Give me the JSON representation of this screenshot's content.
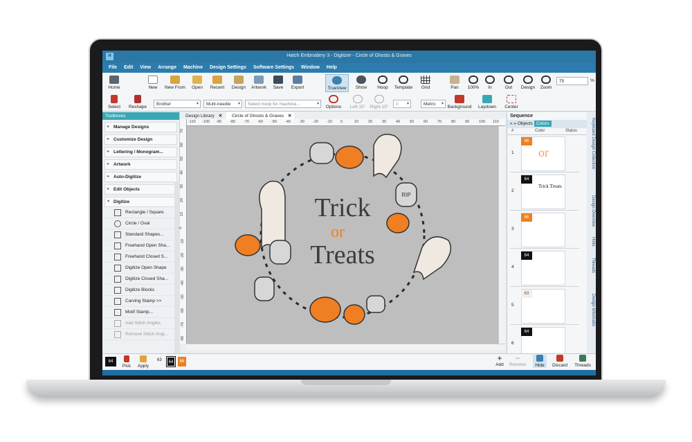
{
  "window": {
    "title": "Hatch Embroidery 3 - Digitizer - Circle of Ghosts & Graves",
    "app_icon": "H"
  },
  "menu": [
    "File",
    "Edit",
    "View",
    "Arrange",
    "Machine",
    "Design Settings",
    "Software Settings",
    "Window",
    "Help"
  ],
  "toolbar": {
    "row1": [
      "Home",
      "New",
      "New From",
      "Open",
      "Recent",
      "Design",
      "Artwork",
      "Save",
      "Export",
      "TrueView",
      "Show",
      "Hoop",
      "Template",
      "Grid",
      "Pan",
      "100%",
      "In",
      "Out",
      "Design",
      "Zoom"
    ],
    "row2": [
      "Select",
      "Reshape",
      "Options",
      "Left 15°",
      "Right 15°",
      "Background",
      "Laydown",
      "Center"
    ],
    "machine_brand": "Brother",
    "machine_type": "Multi-needle",
    "hoop_placeholder": "Select hoop for machine...",
    "angle_value": "0",
    "units": "Metric",
    "zoom_value": "75",
    "zoom_unit": "%"
  },
  "toolboxes": {
    "header": "Toolboxes",
    "sections": [
      "Manage Designs",
      "Customize Design",
      "Lettering / Monogram...",
      "Artwork",
      "Auto-Digitize",
      "Edit Objects",
      "Digitize"
    ],
    "tools": [
      "Rectangle / Square",
      "Circle / Oval",
      "Standard Shapes...",
      "Freehand Open Sha...",
      "Freehand Closed S...",
      "Digitize Open Shape",
      "Digitize Closed Sha...",
      "Digitize Blocks",
      "Carving Stamp >>",
      "Motif Stamp...",
      "Add Stitch Angles",
      "Remove Stitch Angl..."
    ]
  },
  "tabs": [
    "Design Library",
    "Circle of Ghosts & Graves"
  ],
  "ruler": {
    "top": [
      "-110",
      "-100",
      "-90",
      "-80",
      "-70",
      "-60",
      "-50",
      "-40",
      "-30",
      "-20",
      "-10",
      "0",
      "10",
      "20",
      "30",
      "40",
      "50",
      "60",
      "70",
      "80",
      "90",
      "100",
      "110"
    ],
    "left": [
      "70",
      "60",
      "50",
      "40",
      "30",
      "20",
      "10",
      "0",
      "-10",
      "-20",
      "-30",
      "-40",
      "-50",
      "-60",
      "-70",
      "-80"
    ]
  },
  "design": {
    "line1": "Trick",
    "line2": "or",
    "line3": "Treats",
    "grave_text": "RIP"
  },
  "sequence": {
    "title": "Sequence",
    "tabs": [
      "Objects",
      "Colors"
    ],
    "columns": [
      "#",
      "Color",
      "Status"
    ],
    "rows": [
      {
        "num": "1",
        "color_code": "66",
        "color": "#f07f1e",
        "thumb_text": "or"
      },
      {
        "num": "2",
        "color_code": "64",
        "color": "#111111",
        "thumb_text": "Trick Treats"
      },
      {
        "num": "3",
        "color_code": "66",
        "color": "#f07f1e",
        "thumb_text": ""
      },
      {
        "num": "4",
        "color_code": "64",
        "color": "#111111",
        "thumb_text": ""
      },
      {
        "num": "5",
        "color_code": "63",
        "color": "#f2efe8",
        "thumb_text": ""
      },
      {
        "num": "6",
        "color_code": "64",
        "color": "#111111",
        "thumb_text": ""
      }
    ]
  },
  "side_tabs": [
    "Keyboard Design Collection",
    "Design Overview",
    "Hints",
    "Threads",
    "Design Informatio"
  ],
  "bottom": {
    "current_color": "64",
    "pick": "Pick",
    "apply": "Apply",
    "palette": [
      "63",
      "64",
      "66"
    ],
    "add": "Add",
    "remove": "Remove",
    "hide": "Hide",
    "discard": "Discard",
    "threads": "Threads"
  },
  "colors": {
    "accent": "#2b77a6",
    "teal": "#3aa7b5",
    "orange": "#f07f1e",
    "black": "#111111"
  }
}
